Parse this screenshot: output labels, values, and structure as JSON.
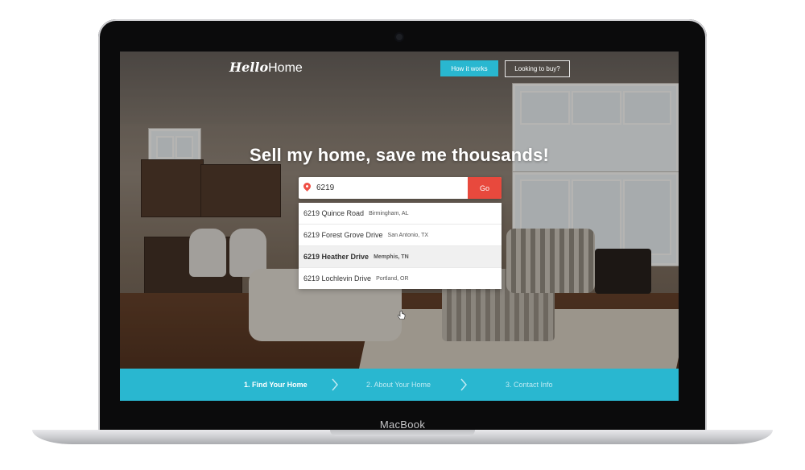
{
  "device": {
    "brand": "MacBook"
  },
  "site": {
    "logo_primary": "Hello",
    "logo_secondary": "Home",
    "nav": {
      "how_it_works": "How it works",
      "looking_to_buy": "Looking to buy?"
    },
    "hero_title": "Sell my home, save me thousands!",
    "search": {
      "value": "6219",
      "go_label": "Go"
    },
    "suggestions": [
      {
        "address": "6219 Quince Road",
        "city": "Birmingham, AL"
      },
      {
        "address": "6219 Forest Grove Drive",
        "city": "San Antonio, TX"
      },
      {
        "address": "6219 Heather Drive",
        "city": "Memphis, TN",
        "highlighted": true
      },
      {
        "address": "6219 Lochlevin Drive",
        "city": "Portland, OR"
      }
    ],
    "steps": [
      {
        "label": "1. Find Your Home",
        "active": true
      },
      {
        "label": "2. About Your Home",
        "active": false
      },
      {
        "label": "3. Contact Info",
        "active": false
      }
    ]
  },
  "colors": {
    "accent": "#29b7d0",
    "go_button": "#e8493d",
    "pin": "#ef4f45"
  },
  "icons": [
    "location-pin-icon",
    "chevron-right-icon",
    "hand-pointer-icon"
  ]
}
